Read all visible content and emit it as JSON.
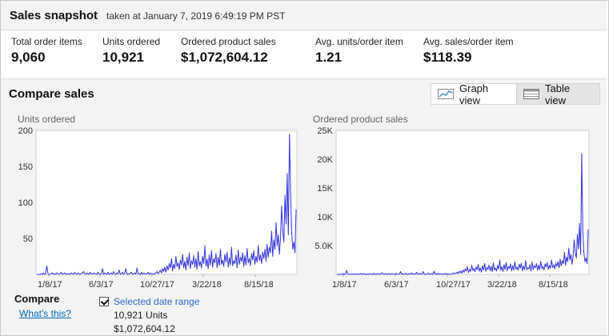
{
  "header": {
    "title": "Sales snapshot",
    "subtitle": "taken at January 7, 2019 6:49:19 PM PST"
  },
  "metrics": [
    {
      "label": "Total order items",
      "value": "9,060"
    },
    {
      "label": "Units ordered",
      "value": "10,921"
    },
    {
      "label": "Ordered product sales",
      "value": "$1,072,604.12"
    },
    {
      "label": "Avg. units/order item",
      "value": "1.21"
    },
    {
      "label": "Avg. sales/order item",
      "value": "$118.39"
    }
  ],
  "compare": {
    "title": "Compare sales",
    "graph_view_label": "Graph view",
    "table_view_label": "Table view",
    "compare_label": "Compare",
    "whats_this_label": "What's this?",
    "selected_range": {
      "label": "Selected date range",
      "checked": true,
      "units_value": "10,921",
      "units_label": "Units",
      "sales_value": "$1,072,604.12"
    }
  },
  "colors": {
    "series": "#3333dd",
    "link": "#0066c0",
    "band": "#f3f3f3"
  },
  "chart_data": [
    {
      "type": "line",
      "title": "Units ordered",
      "ylim": [
        0,
        200
      ],
      "yticks": [
        50,
        100,
        150,
        200
      ],
      "ytick_labels": [
        "50",
        "100",
        "150",
        "200"
      ],
      "xtick_labels": [
        "1/8/17",
        "6/3/17",
        "10/27/17",
        "3/22/18",
        "8/15/18"
      ],
      "grid": false,
      "series": [
        {
          "values": [
            0,
            0,
            0,
            0,
            1,
            0,
            2,
            0,
            1,
            12,
            1,
            0,
            0,
            1,
            2,
            0,
            1,
            0,
            2,
            1,
            0,
            1,
            3,
            0,
            1,
            2,
            0,
            1,
            0,
            1,
            0,
            2,
            1,
            0,
            3,
            1,
            0,
            2,
            1,
            0,
            1,
            2,
            4,
            1,
            0,
            2,
            1,
            0,
            3,
            1,
            0,
            2,
            1,
            1,
            0,
            3,
            1,
            0,
            1,
            8,
            0,
            2,
            1,
            0,
            3,
            0,
            1,
            2,
            0,
            4,
            1,
            0,
            2,
            1,
            6,
            0,
            1,
            3,
            0,
            2,
            8,
            0,
            1,
            0,
            2,
            3,
            0,
            1,
            2,
            0,
            9,
            1,
            1,
            0,
            3,
            0,
            2,
            1,
            0,
            1,
            3,
            0,
            2,
            1,
            0,
            1,
            0,
            2,
            4,
            1,
            3,
            6,
            2,
            8,
            4,
            10,
            3,
            12,
            6,
            15,
            9,
            22,
            5,
            14,
            8,
            25,
            11,
            16,
            7,
            20,
            13,
            28,
            9,
            18,
            6,
            24,
            12,
            30,
            8,
            19,
            14,
            26,
            10,
            22,
            7,
            32,
            12,
            18,
            9,
            25,
            15,
            40,
            11,
            21,
            8,
            27,
            13,
            33,
            10,
            22,
            16,
            29,
            9,
            24,
            12,
            35,
            14,
            20,
            11,
            28,
            17,
            31,
            10,
            23,
            13,
            38,
            12,
            19,
            15,
            27,
            9,
            34,
            14,
            24,
            18,
            30,
            11,
            26,
            13,
            36,
            16,
            22,
            12,
            29,
            20,
            33,
            14,
            25,
            17,
            40,
            19,
            27,
            15,
            31,
            22,
            35,
            18,
            42,
            24,
            38,
            30,
            60,
            25,
            48,
            35,
            72,
            40,
            55,
            28,
            50,
            95,
            60,
            45,
            110,
            70,
            140,
            55,
            195,
            120,
            60,
            35,
            45,
            30,
            90
          ]
        }
      ]
    },
    {
      "type": "line",
      "title": "Ordered product sales",
      "ylim": [
        0,
        25000
      ],
      "yticks": [
        5000,
        10000,
        15000,
        20000,
        25000
      ],
      "ytick_labels": [
        "5.0K",
        "10K",
        "15K",
        "20K",
        "25K"
      ],
      "xtick_labels": [
        "1/8/17",
        "6/3/17",
        "10/27/17",
        "3/22/18",
        "8/15/18"
      ],
      "grid": false,
      "series": [
        {
          "values": [
            0,
            0,
            0,
            0,
            50,
            0,
            150,
            0,
            60,
            700,
            80,
            0,
            0,
            60,
            120,
            0,
            80,
            0,
            130,
            60,
            0,
            70,
            200,
            0,
            70,
            140,
            0,
            70,
            0,
            60,
            0,
            120,
            70,
            0,
            200,
            60,
            0,
            130,
            70,
            0,
            60,
            130,
            260,
            70,
            0,
            130,
            60,
            0,
            190,
            70,
            0,
            130,
            60,
            60,
            0,
            190,
            70,
            0,
            60,
            500,
            0,
            130,
            70,
            0,
            190,
            0,
            60,
            130,
            0,
            250,
            70,
            0,
            130,
            60,
            380,
            0,
            70,
            190,
            0,
            130,
            500,
            0,
            60,
            0,
            130,
            190,
            0,
            70,
            130,
            0,
            560,
            60,
            70,
            0,
            190,
            0,
            130,
            70,
            0,
            60,
            190,
            0,
            130,
            70,
            0,
            60,
            0,
            130,
            250,
            70,
            190,
            380,
            130,
            500,
            250,
            630,
            190,
            760,
            380,
            950,
            570,
            1400,
            320,
            880,
            510,
            1580,
            700,
            1010,
            440,
            1260,
            820,
            1770,
            570,
            1140,
            380,
            1520,
            760,
            1890,
            510,
            1200,
            880,
            1640,
            630,
            1390,
            440,
            2020,
            760,
            1140,
            570,
            1580,
            950,
            2520,
            700,
            1330,
            510,
            1700,
            820,
            2080,
            630,
            1390,
            1010,
            1830,
            570,
            1520,
            760,
            2210,
            880,
            1260,
            700,
            1770,
            1070,
            1960,
            630,
            1450,
            820,
            2400,
            760,
            1200,
            950,
            1700,
            570,
            2140,
            880,
            1520,
            1140,
            1890,
            700,
            1640,
            820,
            2270,
            1010,
            1390,
            760,
            1830,
            1260,
            2080,
            880,
            1580,
            1070,
            2520,
            1200,
            1700,
            950,
            1960,
            1390,
            2210,
            1140,
            2650,
            1520,
            2400,
            1890,
            3800,
            1580,
            3030,
            2210,
            4550,
            2520,
            3470,
            1770,
            3150,
            6000,
            3800,
            2840,
            6950,
            4420,
            8840,
            3470,
            21000,
            7580,
            3800,
            2210,
            2840,
            1890,
            7800
          ]
        }
      ]
    }
  ]
}
